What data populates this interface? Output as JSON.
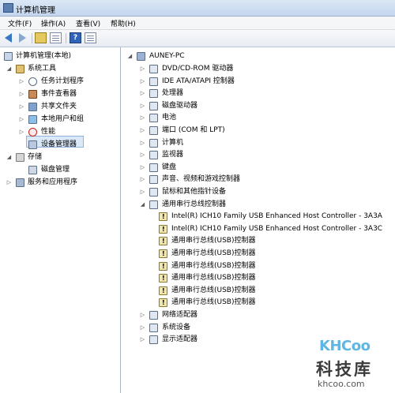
{
  "window": {
    "title": "计算机管理"
  },
  "menu": [
    "文件(F)",
    "操作(A)",
    "查看(V)",
    "帮助(H)"
  ],
  "toolbar": {
    "help_glyph": "?"
  },
  "left_tree": [
    {
      "label": "计算机管理(本地)",
      "icon": "computer-management-icon",
      "expander": ""
    },
    {
      "label": "系统工具",
      "icon": "system-tools-icon",
      "expander": "◢"
    },
    {
      "label": "任务计划程序",
      "icon": "task-scheduler-icon",
      "expander": "▷"
    },
    {
      "label": "事件查看器",
      "icon": "event-viewer-icon",
      "expander": "▷"
    },
    {
      "label": "共享文件夹",
      "icon": "shared-folders-icon",
      "expander": "▷"
    },
    {
      "label": "本地用户和组",
      "icon": "local-users-icon",
      "expander": "▷"
    },
    {
      "label": "性能",
      "icon": "performance-icon",
      "expander": "▷"
    },
    {
      "label": "设备管理器",
      "icon": "device-manager-icon",
      "expander": "",
      "selected": true
    },
    {
      "label": "存储",
      "icon": "storage-icon",
      "expander": "◢"
    },
    {
      "label": "磁盘管理",
      "icon": "disk-management-icon",
      "expander": ""
    },
    {
      "label": "服务和应用程序",
      "icon": "services-apps-icon",
      "expander": "▷"
    }
  ],
  "device_tree": {
    "root": "AUNEY-PC",
    "items": [
      {
        "label": "DVD/CD-ROM 驱动器",
        "icon": "dvd-drive-icon",
        "expander": "▷",
        "warn": false
      },
      {
        "label": "IDE ATA/ATAPI 控制器",
        "icon": "ide-controller-icon",
        "expander": "▷",
        "warn": false
      },
      {
        "label": "处理器",
        "icon": "processor-icon",
        "expander": "▷",
        "warn": false
      },
      {
        "label": "磁盘驱动器",
        "icon": "disk-drive-icon",
        "expander": "▷",
        "warn": false
      },
      {
        "label": "电池",
        "icon": "battery-icon",
        "expander": "▷",
        "warn": false
      },
      {
        "label": "端口 (COM 和 LPT)",
        "icon": "port-icon",
        "expander": "▷",
        "warn": false
      },
      {
        "label": "计算机",
        "icon": "computer-icon",
        "expander": "▷",
        "warn": false
      },
      {
        "label": "监视器",
        "icon": "monitor-icon",
        "expander": "▷",
        "warn": false
      },
      {
        "label": "键盘",
        "icon": "keyboard-icon",
        "expander": "▷",
        "warn": false
      },
      {
        "label": "声音、视频和游戏控制器",
        "icon": "sound-icon",
        "expander": "▷",
        "warn": false
      },
      {
        "label": "鼠标和其他指针设备",
        "icon": "mouse-icon",
        "expander": "▷",
        "warn": false
      },
      {
        "label": "通用串行总线控制器",
        "icon": "usb-controller-icon",
        "expander": "◢",
        "warn": false
      },
      {
        "label": "Intel(R) ICH10 Family USB Enhanced Host Controller - 3A3A",
        "icon": "usb-warning-icon",
        "expander": "",
        "warn": true,
        "child": true
      },
      {
        "label": "Intel(R) ICH10 Family USB Enhanced Host Controller - 3A3C",
        "icon": "usb-warning-icon",
        "expander": "",
        "warn": true,
        "child": true
      },
      {
        "label": "通用串行总线(USB)控制器",
        "icon": "usb-warning-icon",
        "expander": "",
        "warn": true,
        "child": true
      },
      {
        "label": "通用串行总线(USB)控制器",
        "icon": "usb-warning-icon",
        "expander": "",
        "warn": true,
        "child": true
      },
      {
        "label": "通用串行总线(USB)控制器",
        "icon": "usb-warning-icon",
        "expander": "",
        "warn": true,
        "child": true
      },
      {
        "label": "通用串行总线(USB)控制器",
        "icon": "usb-warning-icon",
        "expander": "",
        "warn": true,
        "child": true
      },
      {
        "label": "通用串行总线(USB)控制器",
        "icon": "usb-warning-icon",
        "expander": "",
        "warn": true,
        "child": true
      },
      {
        "label": "通用串行总线(USB)控制器",
        "icon": "usb-warning-icon",
        "expander": "",
        "warn": true,
        "child": true
      },
      {
        "label": "网络适配器",
        "icon": "network-adapter-icon",
        "expander": "▷",
        "warn": false
      },
      {
        "label": "系统设备",
        "icon": "system-devices-icon",
        "expander": "▷",
        "warn": false
      },
      {
        "label": "显示适配器",
        "icon": "display-adapter-icon",
        "expander": "▷",
        "warn": false
      }
    ]
  },
  "watermark": {
    "brand": "KHCoo",
    "cn": "科技库",
    "url": "khcoo.com"
  }
}
